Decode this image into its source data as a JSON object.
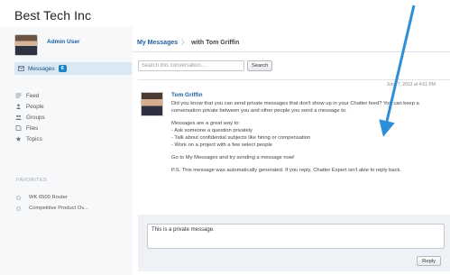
{
  "app": {
    "title": "Best Tech Inc"
  },
  "user": {
    "name": "Admin User"
  },
  "sidebar": {
    "active": {
      "label": "Messages",
      "count": "6",
      "icon": "envelope-icon"
    },
    "items": [
      {
        "label": "Feed",
        "icon": "feed-icon"
      },
      {
        "label": "People",
        "icon": "person-icon"
      },
      {
        "label": "Groups",
        "icon": "groups-icon"
      },
      {
        "label": "Files",
        "icon": "file-icon"
      },
      {
        "label": "Topics",
        "icon": "topics-icon"
      }
    ],
    "favorites_header": "FAVORITES",
    "favorites": [
      {
        "label": "WK 6500 Router"
      },
      {
        "label": "Competitive Product Ov..."
      }
    ]
  },
  "main": {
    "breadcrumb": {
      "link": "My Messages",
      "separator": "〉",
      "current": "with Tom Griffin"
    },
    "search": {
      "placeholder": "Search this conversation...",
      "button": "Search"
    }
  },
  "message": {
    "timestamp": "June 7, 2013 at 4:01 PM",
    "author": "Tom Griffin",
    "paragraphs": [
      "Did you know that you can send private messages that don't show up in your Chatter feed? You can keep a conversation private between you and other people you send a message to.",
      "Messages are a great way to:\n- Ask someone a question privately\n- Talk about confidential subjects like hiring or compensation\n- Work on a project with a few select people",
      "Go to My Messages and try sending a message now!",
      "P.S. This message was automatically generated. If you reply, Chatter Expert isn't able to reply back."
    ]
  },
  "reply": {
    "value": "This is a private message.",
    "button": "Reply"
  },
  "colors": {
    "link": "#1e5fa3",
    "arrow": "#2f8fd6",
    "badge": "#1e84c6",
    "active_nav": "#d9e8f5"
  }
}
